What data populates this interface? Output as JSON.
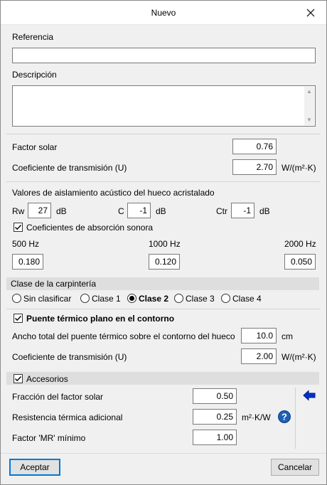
{
  "window": {
    "title": "Nuevo"
  },
  "referencia": {
    "label": "Referencia",
    "value": ""
  },
  "descripcion": {
    "label": "Descripción",
    "value": ""
  },
  "factor_solar": {
    "label": "Factor solar",
    "value": "0.76"
  },
  "coef_transmision": {
    "label": "Coeficiente de transmisión (U)",
    "value": "2.70",
    "unit": "W/(m²·K)"
  },
  "acustico": {
    "heading": "Valores de aislamiento acústico del hueco acristalado",
    "rw_label": "Rw",
    "rw_value": "27",
    "rw_unit": "dB",
    "c_label": "C",
    "c_value": "-1",
    "c_unit": "dB",
    "ctr_label": "Ctr",
    "ctr_value": "-1",
    "ctr_unit": "dB",
    "absorcion_label": "Coeficientes de absorción sonora",
    "absorcion_checked": true,
    "freq": [
      {
        "label": "500 Hz",
        "value": "0.180"
      },
      {
        "label": "1000 Hz",
        "value": "0.120"
      },
      {
        "label": "2000 Hz",
        "value": "0.050"
      }
    ]
  },
  "carpinteria": {
    "heading": "Clase de la carpintería",
    "options": [
      "Sin clasificar",
      "Clase 1",
      "Clase 2",
      "Clase 3",
      "Clase 4"
    ],
    "selected": "Clase 2"
  },
  "puente": {
    "label": "Puente térmico plano en el contorno",
    "checked": true,
    "ancho_label": "Ancho total del puente térmico sobre el contorno del hueco",
    "ancho_value": "10.0",
    "ancho_unit": "cm",
    "coef_label": "Coeficiente de transmisión (U)",
    "coef_value": "2.00",
    "coef_unit": "W/(m²·K)"
  },
  "accesorios": {
    "label": "Accesorios",
    "checked": true,
    "fraccion_label": "Fracción del factor solar",
    "fraccion_value": "0.50",
    "resistencia_label": "Resistencia térmica adicional",
    "resistencia_value": "0.25",
    "resistencia_unit": "m²·K/W",
    "mr_label": "Factor 'MR' mínimo",
    "mr_value": "1.00"
  },
  "buttons": {
    "accept": "Aceptar",
    "cancel": "Cancelar"
  },
  "colors": {
    "accent": "#0078d7",
    "arrow": "#0033cc",
    "help": "#1f5fb8"
  }
}
